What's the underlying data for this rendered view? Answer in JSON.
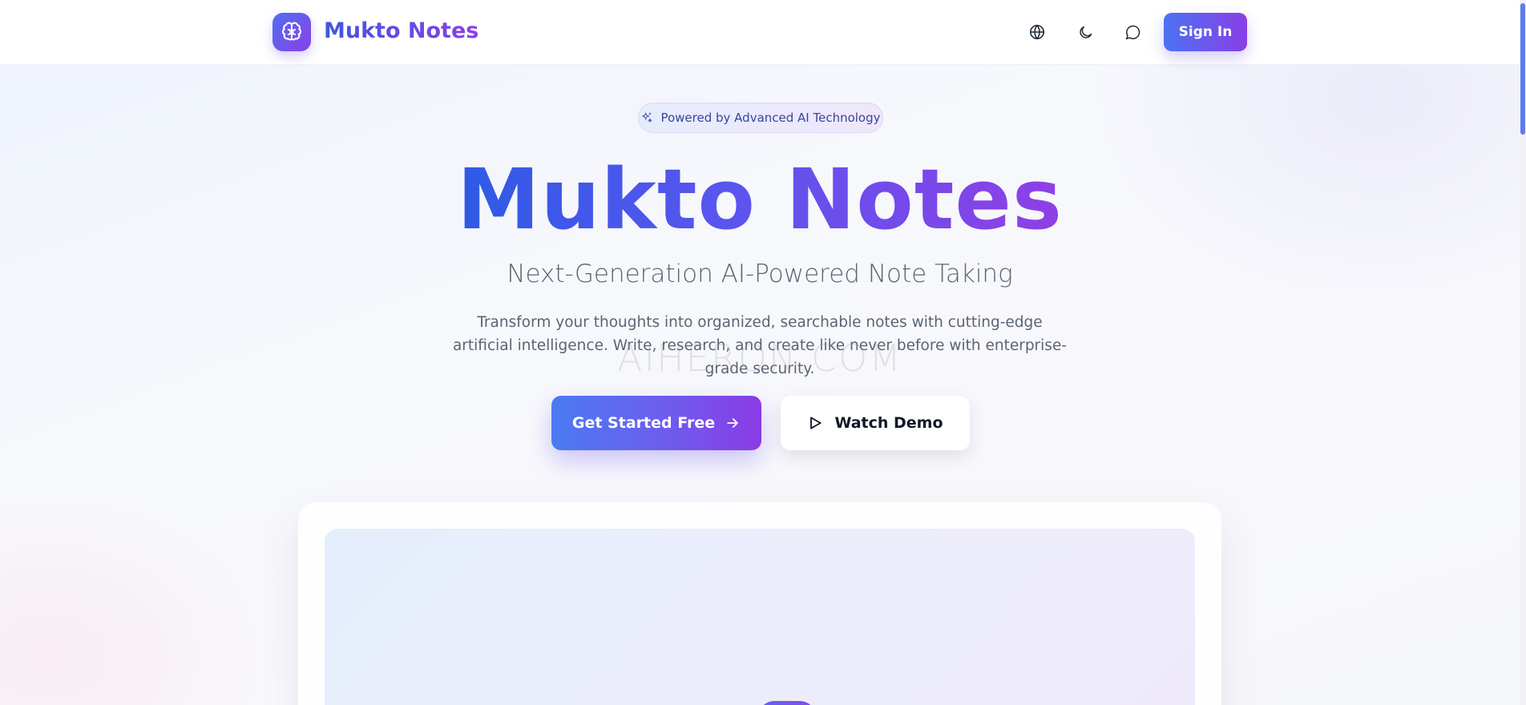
{
  "header": {
    "brand": "Mukto Notes",
    "logo_icon": "brain-icon",
    "language_icon": "globe-icon",
    "theme_icon": "moon-icon",
    "chat_icon": "chat-bubble-icon",
    "sign_in_label": "Sign In"
  },
  "hero": {
    "badge_icon": "sparkles-icon",
    "badge_text": "Powered by Advanced AI Technology",
    "title": "Mukto Notes",
    "subtitle": "Next-Generation AI-Powered Note Taking",
    "description": "Transform your thoughts into organized, searchable notes with cutting-edge artificial intelligence. Write, research, and create like never before with enterprise-grade security.",
    "primary_cta": "Get Started Free",
    "primary_cta_icon": "arrow-right-icon",
    "secondary_cta": "Watch Demo",
    "secondary_cta_icon": "play-icon"
  },
  "watermark": "AIHERON.COM",
  "colors": {
    "accent_start": "#4b72f2",
    "accent_end": "#8a3fe6",
    "text_muted": "#5b6473"
  }
}
